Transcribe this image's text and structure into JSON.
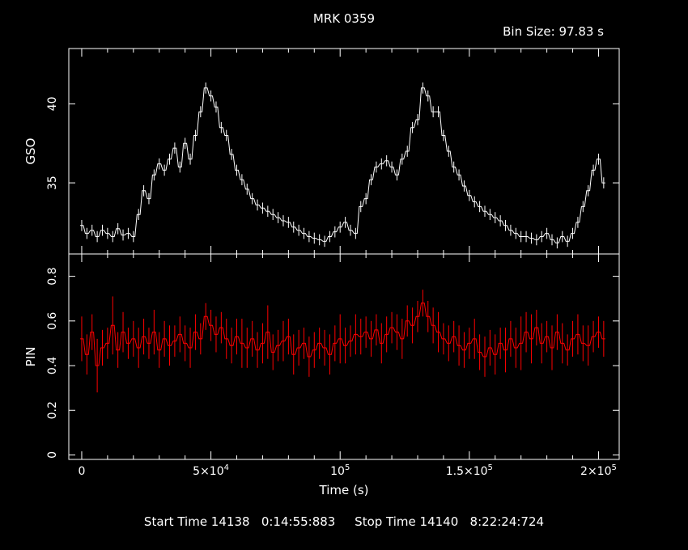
{
  "title": "MRK 0359",
  "bin_size_label": "Bin Size: 97.83 s",
  "footer": "Start Time 14138   0:14:55:883     Stop Time 14140   8:22:24:724",
  "colors": {
    "background": "#000000",
    "axes": "#ffffff",
    "gso": "#ffffff",
    "pin": "#ff0000"
  },
  "chart_data": [
    {
      "type": "line",
      "panel": "top",
      "ylabel": "GSO",
      "xlim": [
        -5000,
        208000
      ],
      "ylim": [
        30.5,
        43.5
      ],
      "yticks": [
        35,
        40
      ],
      "series": [
        {
          "x": [
            0,
            2000,
            4000,
            6000,
            8000,
            10000,
            12000,
            14000,
            16000,
            18000,
            20000,
            22000,
            24000,
            26000,
            28000,
            30000,
            32000,
            34000,
            36000,
            38000,
            40000,
            42000,
            44000,
            46000,
            48000,
            50000,
            52000,
            54000,
            56000,
            58000,
            60000,
            62000,
            64000,
            66000,
            68000,
            70000,
            72000,
            74000,
            76000,
            78000,
            80000,
            82000,
            84000,
            86000,
            88000,
            90000,
            92000,
            94000,
            96000,
            98000,
            100000,
            102000,
            104000,
            106000,
            108000,
            110000,
            112000,
            114000,
            116000,
            118000,
            120000,
            122000,
            124000,
            126000,
            128000,
            130000,
            132000,
            134000,
            136000,
            138000,
            140000,
            142000,
            144000,
            146000,
            148000,
            150000,
            152000,
            154000,
            156000,
            158000,
            160000,
            162000,
            164000,
            166000,
            168000,
            170000,
            172000,
            174000,
            176000,
            178000,
            180000,
            182000,
            184000,
            186000,
            188000,
            190000,
            192000,
            194000,
            196000,
            198000,
            200000,
            202000
          ],
          "y": [
            32.3,
            31.8,
            32.0,
            31.6,
            32.0,
            31.8,
            31.6,
            32.1,
            31.7,
            31.8,
            31.6,
            33.0,
            34.5,
            34.0,
            35.5,
            36.2,
            35.8,
            36.5,
            37.2,
            36.0,
            37.5,
            36.5,
            38.0,
            39.5,
            41.0,
            40.5,
            39.8,
            38.5,
            38.0,
            36.8,
            35.8,
            35.2,
            34.6,
            34.0,
            33.6,
            33.4,
            33.2,
            33.0,
            32.8,
            32.6,
            32.5,
            32.2,
            32.0,
            31.8,
            31.6,
            31.5,
            31.4,
            31.3,
            31.6,
            31.9,
            32.2,
            32.5,
            32.0,
            31.8,
            33.5,
            34.0,
            35.2,
            36.0,
            36.2,
            36.4,
            36.0,
            35.5,
            36.5,
            37.0,
            38.5,
            39.0,
            41.0,
            40.5,
            39.5,
            39.5,
            38.0,
            37.0,
            36.0,
            35.5,
            34.8,
            34.2,
            33.8,
            33.5,
            33.2,
            33.0,
            32.8,
            32.6,
            32.3,
            32.0,
            31.8,
            31.6,
            31.6,
            31.5,
            31.4,
            31.6,
            31.8,
            31.4,
            31.2,
            31.6,
            31.3,
            31.8,
            32.5,
            33.5,
            34.5,
            35.8,
            36.5,
            35.0
          ]
        }
      ]
    },
    {
      "type": "line",
      "panel": "bottom",
      "xlabel": "Time (s)",
      "ylabel": "PIN",
      "xlim": [
        -5000,
        208000
      ],
      "ylim": [
        -0.02,
        0.9
      ],
      "yticks": [
        0,
        0.2,
        0.4,
        0.6,
        0.8
      ],
      "xticks": [
        0,
        50000,
        100000,
        150000,
        200000
      ],
      "xtick_labels": [
        "0",
        "5×10",
        "10",
        "1.5×10",
        "2×10"
      ],
      "xtick_exps": [
        "",
        "4",
        "5",
        "5",
        "5"
      ],
      "series": [
        {
          "x": [
            0,
            2000,
            4000,
            6000,
            8000,
            10000,
            12000,
            14000,
            16000,
            18000,
            20000,
            22000,
            24000,
            26000,
            28000,
            30000,
            32000,
            34000,
            36000,
            38000,
            40000,
            42000,
            44000,
            46000,
            48000,
            50000,
            52000,
            54000,
            56000,
            58000,
            60000,
            62000,
            64000,
            66000,
            68000,
            70000,
            72000,
            74000,
            76000,
            78000,
            80000,
            82000,
            84000,
            86000,
            88000,
            90000,
            92000,
            94000,
            96000,
            98000,
            100000,
            102000,
            104000,
            106000,
            108000,
            110000,
            112000,
            114000,
            116000,
            118000,
            120000,
            122000,
            124000,
            126000,
            128000,
            130000,
            132000,
            134000,
            136000,
            138000,
            140000,
            142000,
            144000,
            146000,
            148000,
            150000,
            152000,
            154000,
            156000,
            158000,
            160000,
            162000,
            164000,
            166000,
            168000,
            170000,
            172000,
            174000,
            176000,
            178000,
            180000,
            182000,
            184000,
            186000,
            188000,
            190000,
            192000,
            194000,
            196000,
            198000,
            200000,
            202000
          ],
          "y": [
            0.52,
            0.45,
            0.55,
            0.4,
            0.48,
            0.5,
            0.58,
            0.47,
            0.55,
            0.5,
            0.52,
            0.48,
            0.53,
            0.5,
            0.55,
            0.47,
            0.52,
            0.49,
            0.51,
            0.54,
            0.5,
            0.48,
            0.55,
            0.52,
            0.62,
            0.58,
            0.54,
            0.57,
            0.52,
            0.49,
            0.53,
            0.5,
            0.48,
            0.52,
            0.47,
            0.5,
            0.55,
            0.46,
            0.49,
            0.51,
            0.53,
            0.45,
            0.48,
            0.5,
            0.44,
            0.47,
            0.5,
            0.48,
            0.45,
            0.5,
            0.52,
            0.49,
            0.51,
            0.54,
            0.53,
            0.55,
            0.52,
            0.56,
            0.5,
            0.54,
            0.57,
            0.55,
            0.52,
            0.6,
            0.58,
            0.62,
            0.68,
            0.62,
            0.58,
            0.55,
            0.52,
            0.5,
            0.53,
            0.49,
            0.47,
            0.5,
            0.52,
            0.46,
            0.44,
            0.48,
            0.45,
            0.5,
            0.47,
            0.52,
            0.48,
            0.5,
            0.55,
            0.52,
            0.57,
            0.5,
            0.53,
            0.48,
            0.55,
            0.5,
            0.47,
            0.52,
            0.54,
            0.5,
            0.49,
            0.53,
            0.55,
            0.52
          ],
          "err": [
            0.1,
            0.09,
            0.08,
            0.12,
            0.08,
            0.07,
            0.13,
            0.08,
            0.09,
            0.07,
            0.08,
            0.09,
            0.08,
            0.07,
            0.1,
            0.08,
            0.08,
            0.09,
            0.07,
            0.08,
            0.08,
            0.09,
            0.08,
            0.07,
            0.06,
            0.07,
            0.08,
            0.07,
            0.09,
            0.08,
            0.08,
            0.11,
            0.09,
            0.08,
            0.08,
            0.09,
            0.12,
            0.08,
            0.07,
            0.09,
            0.08,
            0.09,
            0.08,
            0.07,
            0.09,
            0.08,
            0.07,
            0.08,
            0.09,
            0.08,
            0.11,
            0.08,
            0.07,
            0.09,
            0.08,
            0.07,
            0.08,
            0.07,
            0.09,
            0.08,
            0.07,
            0.08,
            0.09,
            0.07,
            0.08,
            0.07,
            0.06,
            0.07,
            0.08,
            0.09,
            0.07,
            0.08,
            0.07,
            0.09,
            0.08,
            0.07,
            0.09,
            0.08,
            0.09,
            0.08,
            0.09,
            0.07,
            0.1,
            0.08,
            0.09,
            0.12,
            0.09,
            0.11,
            0.08,
            0.09,
            0.07,
            0.1,
            0.08,
            0.09,
            0.07,
            0.08,
            0.09,
            0.08,
            0.09,
            0.07,
            0.07,
            0.08
          ]
        }
      ]
    }
  ]
}
